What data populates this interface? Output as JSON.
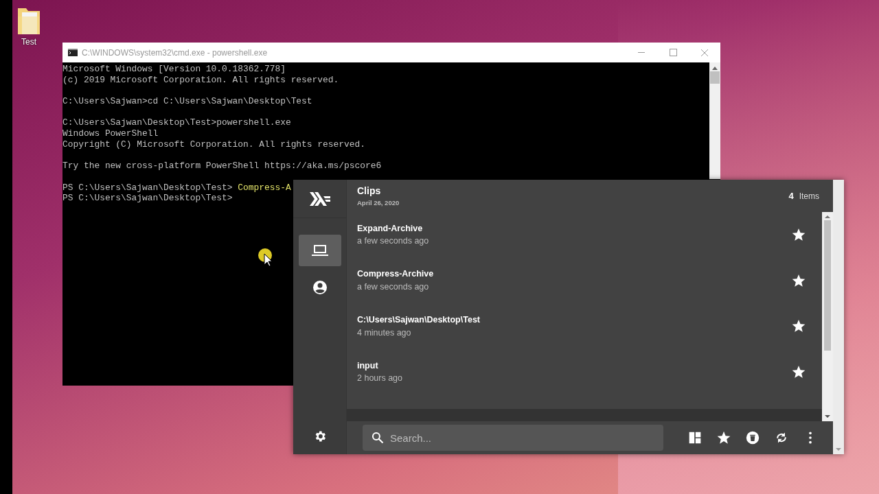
{
  "desktop": {
    "icons": [
      {
        "label": "Test"
      }
    ]
  },
  "terminal": {
    "title": "C:\\WINDOWS\\system32\\cmd.exe - powershell.exe",
    "blocks": [
      [
        {
          "text": "Microsoft Windows [Version 10.0.18362.778]"
        },
        {
          "text": "(c) 2019 Microsoft Corporation. All rights reserved."
        }
      ],
      [
        {
          "text": "C:\\Users\\Sajwan>cd C:\\Users\\Sajwan\\Desktop\\Test"
        }
      ],
      [
        {
          "text": "C:\\Users\\Sajwan\\Desktop\\Test>powershell.exe"
        },
        {
          "text": "Windows PowerShell"
        },
        {
          "text": "Copyright (C) Microsoft Corporation. All rights reserved."
        }
      ],
      [
        {
          "text": "Try the new cross-platform PowerShell https://aka.ms/pscore6"
        }
      ],
      [
        {
          "text": "PS C:\\Users\\Sajwan\\Desktop\\Test> ",
          "command": "Compress-A"
        },
        {
          "text": "PS C:\\Users\\Sajwan\\Desktop\\Test>"
        }
      ]
    ]
  },
  "clips_app": {
    "sidebar": {
      "items": [
        {
          "kind": "device",
          "selected": true
        },
        {
          "kind": "account",
          "selected": false
        }
      ]
    },
    "header": {
      "title": "Clips",
      "date": "April 26, 2020",
      "count": "4",
      "count_label": "Items"
    },
    "clips": [
      {
        "text": "Expand-Archive",
        "time": "a few seconds ago"
      },
      {
        "text": "Compress-Archive",
        "time": "a few seconds ago"
      },
      {
        "text": "C:\\Users\\Sajwan\\Desktop\\Test",
        "time": "4 minutes ago"
      },
      {
        "text": "input",
        "time": "2 hours ago"
      }
    ],
    "search": {
      "placeholder": "Search..."
    }
  }
}
